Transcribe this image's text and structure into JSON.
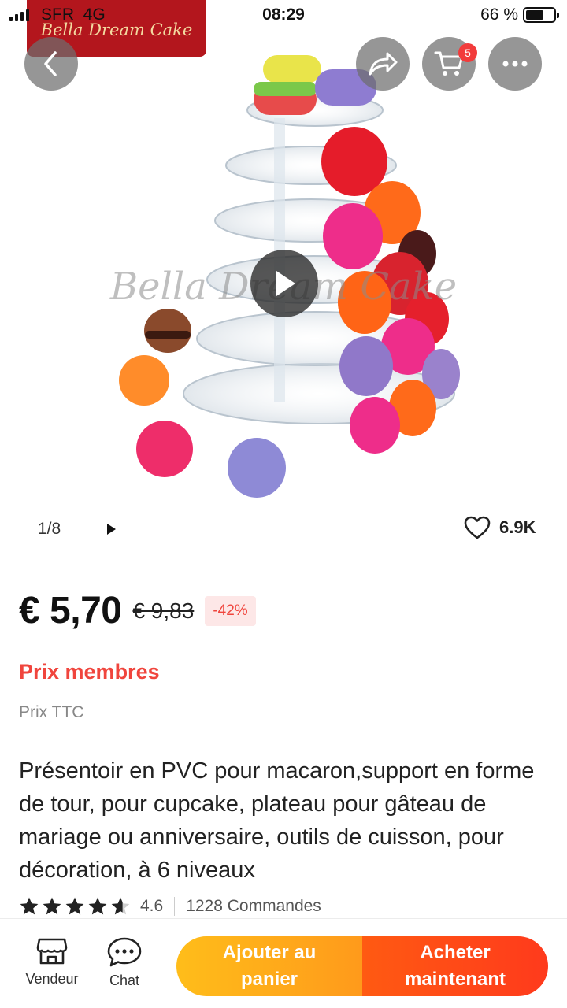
{
  "status_bar": {
    "carrier": "SFR",
    "network": "4G",
    "time": "08:29",
    "battery_percent": "66 %",
    "battery_level": 0.66
  },
  "hero": {
    "watermark_logo": "Bella Dream Cake",
    "watermark_center": "Bella Dream Cake",
    "cart_badge": "5",
    "image_index": "1/8",
    "favorites": "6.9K"
  },
  "product": {
    "price": "€ 5,70",
    "old_price": "€ 9,83",
    "discount": "-42%",
    "members_label": "Prix membres",
    "tax_label": "Prix TTC",
    "title": "Présentoir en PVC pour macaron,support en forme de tour, pour cupcake, plateau pour gâteau de mariage ou anniversaire, outils de cuisson, pour décoration, à 6 niveaux",
    "rating": "4.6",
    "rating_value": 4.6,
    "orders": "1228 Commandes"
  },
  "bottom_bar": {
    "vendeur_label": "Vendeur",
    "chat_label": "Chat",
    "add_to_cart": "Ajouter au panier",
    "buy_now": "Acheter maintenant"
  },
  "colors": {
    "accent_red": "#f0453d",
    "cta_orange": "#ff9a1b",
    "cta_red": "#ff3a1c",
    "logo_bg": "#b3161d"
  }
}
